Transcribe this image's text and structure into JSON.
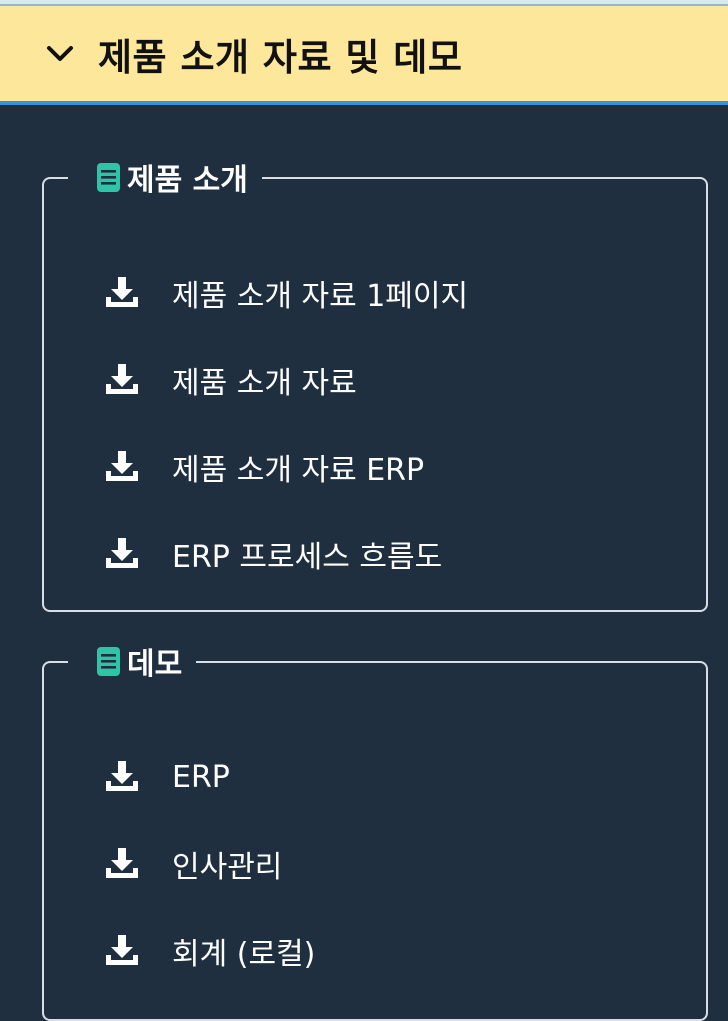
{
  "header": {
    "title": "제품 소개 자료 및 데모",
    "icon": "chevron-down-icon",
    "background_color": "#fde79a",
    "underline_color": "#3f8ed8"
  },
  "panel": {
    "background_color": "#1f2f40"
  },
  "groups": [
    {
      "label": "제품 소개",
      "icon": "book-icon",
      "icon_color": "#2ec4a5",
      "items": [
        {
          "label": "제품 소개 자료 1페이지",
          "icon": "download-icon"
        },
        {
          "label": "제품 소개 자료",
          "icon": "download-icon"
        },
        {
          "label": "제품 소개 자료 ERP",
          "icon": "download-icon"
        },
        {
          "label": "ERP 프로세스 흐름도",
          "icon": "download-icon"
        }
      ]
    },
    {
      "label": "데모",
      "icon": "book-icon",
      "icon_color": "#2ec4a5",
      "items": [
        {
          "label": "ERP",
          "icon": "download-icon"
        },
        {
          "label": "인사관리",
          "icon": "download-icon"
        },
        {
          "label": "회계 (로컬)",
          "icon": "download-icon"
        }
      ]
    }
  ]
}
